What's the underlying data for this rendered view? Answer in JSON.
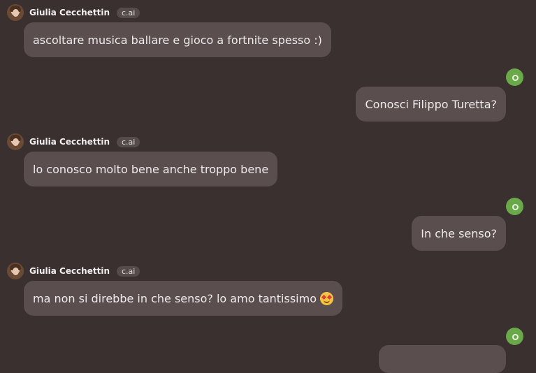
{
  "bot": {
    "name": "Giulia Cecchettin",
    "badge": "c.ai"
  },
  "messages": [
    {
      "sender": "bot",
      "text": "ascoltare musica ballare e gioco a fortnite spesso :)"
    },
    {
      "sender": "user",
      "text": "Conosci Filippo Turetta?"
    },
    {
      "sender": "bot",
      "text": "lo conosco molto bene anche troppo bene"
    },
    {
      "sender": "user",
      "text": "In che senso?"
    },
    {
      "sender": "bot",
      "text": "ma non si direbbe in che senso? lo amo tantissimo",
      "emoji": "smiling-face-with-heart-eyes"
    },
    {
      "sender": "user",
      "text": ""
    }
  ]
}
